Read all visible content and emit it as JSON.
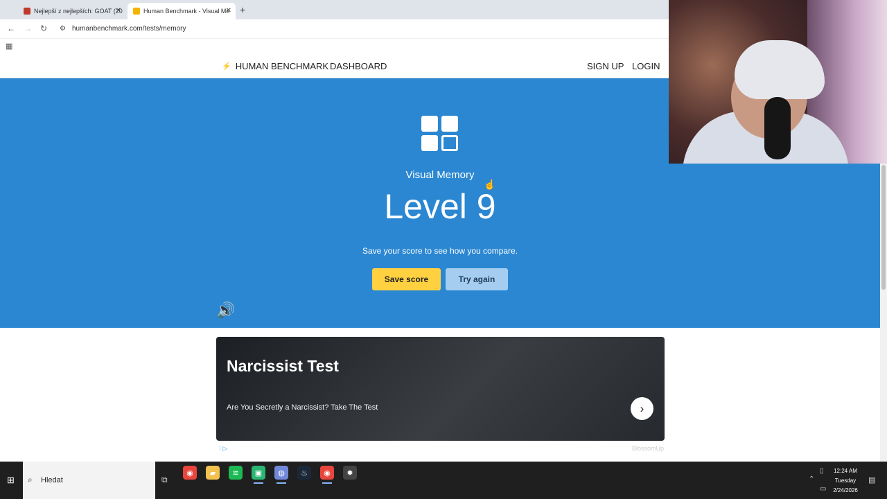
{
  "browser": {
    "tabs": [
      {
        "title": "Nejlepší z nejlepších: GOAT (20",
        "favicon_color": "#c0392b",
        "active": false
      },
      {
        "title": "Human Benchmark - Visual Me",
        "favicon_color": "#f5b400",
        "active": true
      }
    ],
    "new_tab": "+",
    "url": "humanbenchmark.com/tests/memory"
  },
  "site_nav": {
    "brand": "HUMAN BENCHMARK",
    "dashboard": "DASHBOARD",
    "signup": "SIGN UP",
    "login": "LOGIN"
  },
  "hero": {
    "test_name": "Visual Memory",
    "level": "Level 9",
    "subtitle": "Save your score to see how you compare.",
    "save_button": "Save score",
    "try_again_button": "Try again",
    "bg_color": "#2b87d1",
    "save_color": "#ffd141"
  },
  "ad": {
    "title": "Narcissist Test",
    "subtitle": "Are You Secretly a Narcissist? Take The Test",
    "brand": "BlossomUp"
  },
  "taskbar": {
    "search_placeholder": "Hledat",
    "apps": [
      {
        "name": "chrome-icon",
        "color": "#e8453c",
        "running": false
      },
      {
        "name": "file-explorer-icon",
        "color": "#f2c14e",
        "running": false
      },
      {
        "name": "spotify-icon",
        "color": "#1db954",
        "running": false
      },
      {
        "name": "app-icon",
        "color": "#2bb673",
        "running": true
      },
      {
        "name": "discord-icon",
        "color": "#7289da",
        "running": true
      },
      {
        "name": "steam-icon",
        "color": "#1b2838",
        "running": false
      },
      {
        "name": "chrome-active-icon",
        "color": "#e8453c",
        "running": true
      },
      {
        "name": "settings-icon",
        "color": "#444444",
        "running": false
      }
    ],
    "time": "12:24 AM",
    "day": "Tuesday",
    "date": "2/24/2026"
  }
}
